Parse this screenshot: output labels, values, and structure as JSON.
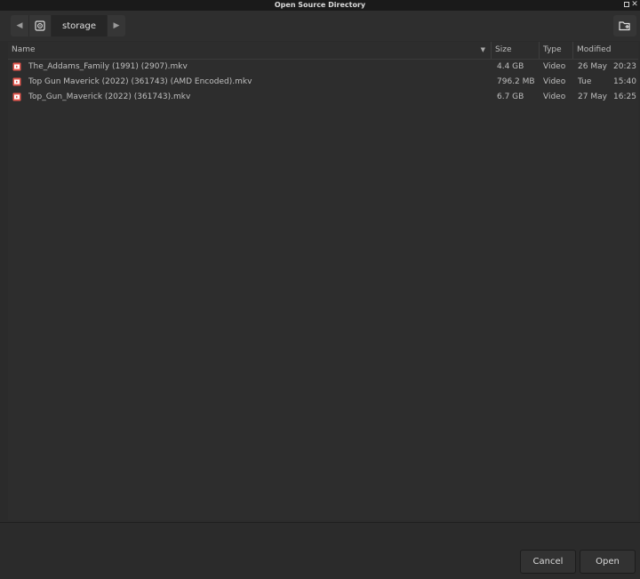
{
  "window": {
    "title": "Open Source Directory"
  },
  "pathbar": {
    "current": "storage"
  },
  "columns": {
    "name": "Name",
    "size": "Size",
    "type": "Type",
    "modified": "Modified"
  },
  "files": [
    {
      "name": "The_Addams_Family (1991) (2907).mkv",
      "size": "4.4 GB",
      "type": "Video",
      "date": "26 May",
      "time": "20:23"
    },
    {
      "name": "Top Gun Maverick (2022) (361743) (AMD Encoded).mkv",
      "size": "796.2 MB",
      "type": "Video",
      "date": "Tue",
      "time": "15:40"
    },
    {
      "name": "Top_Gun_Maverick (2022) (361743).mkv",
      "size": "6.7 GB",
      "type": "Video",
      "date": "27 May",
      "time": "16:25"
    }
  ],
  "buttons": {
    "cancel": "Cancel",
    "open": "Open"
  },
  "colors": {
    "video_icon": "#e8584f"
  }
}
